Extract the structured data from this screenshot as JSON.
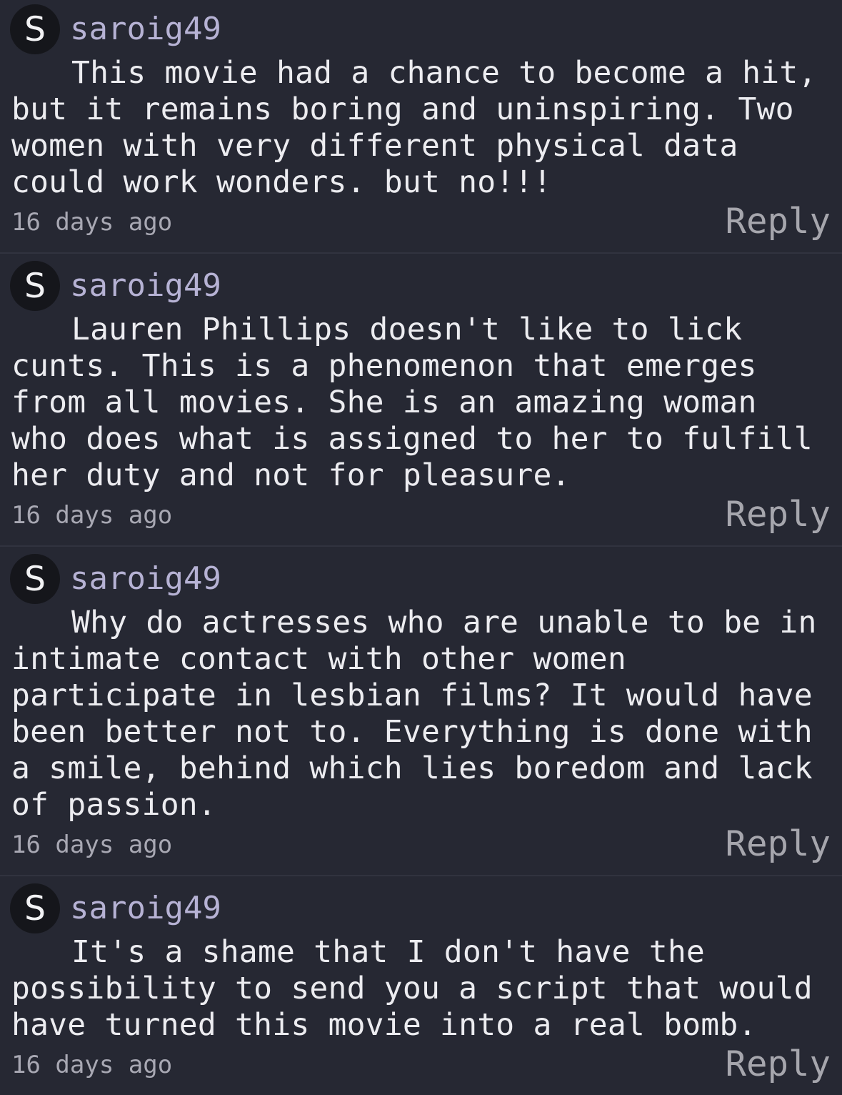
{
  "comments": [
    {
      "avatar_letter": "S",
      "username": "saroig49",
      "text": "This movie had a chance to become a hit, but it remains boring and uninspiring. Two women with very different physical data could work wonders. but no!!!",
      "timestamp": "16 days ago",
      "reply_label": "Reply"
    },
    {
      "avatar_letter": "S",
      "username": "saroig49",
      "text": "Lauren Phillips doesn't like to lick cunts. This is a phenomenon that emerges from all movies. She is an amazing woman who does what is assigned to her to fulfill her duty and not for pleasure.",
      "timestamp": "16 days ago",
      "reply_label": "Reply"
    },
    {
      "avatar_letter": "S",
      "username": "saroig49",
      "text": "Why do actresses who are unable to be in intimate contact with other women participate in lesbian films? It would have been better not to. Everything is done with a smile, behind which lies boredom and lack of passion.",
      "timestamp": "16 days ago",
      "reply_label": "Reply"
    },
    {
      "avatar_letter": "S",
      "username": "saroig49",
      "text": "It's a shame that I don't have the possibility to send you a script that would have turned this movie into a real bomb.",
      "timestamp": "16 days ago",
      "reply_label": "Reply"
    }
  ]
}
